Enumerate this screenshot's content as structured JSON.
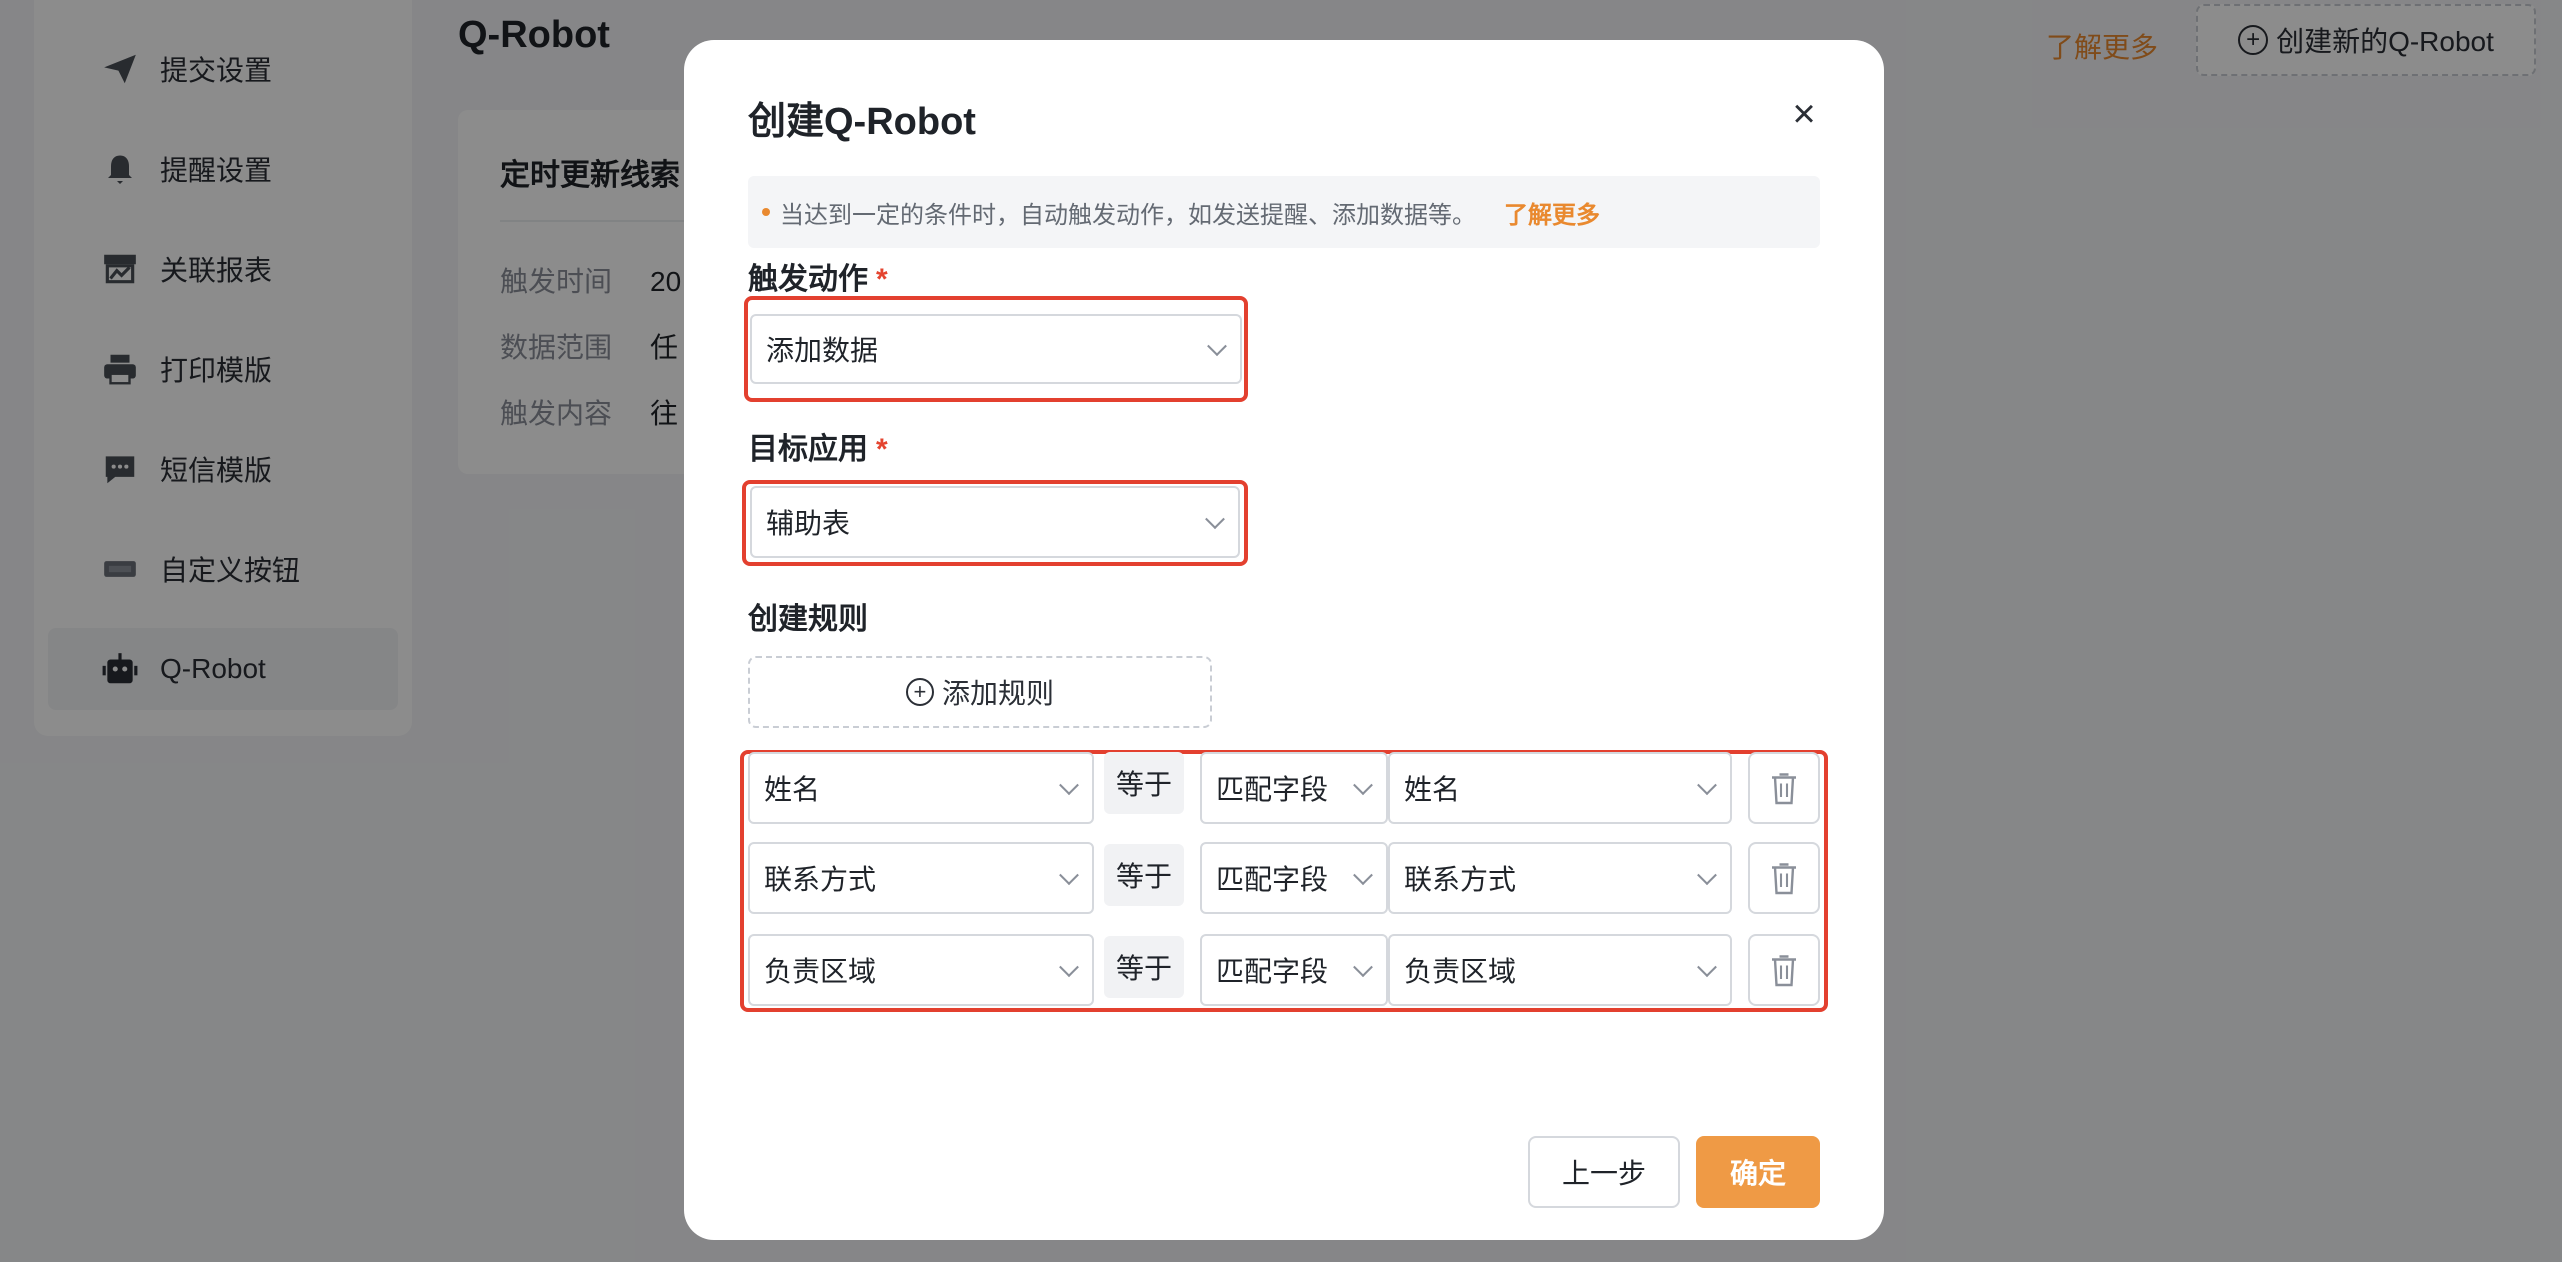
{
  "sidebar": {
    "items": [
      {
        "label": "提交设置",
        "icon": "paper-plane-icon"
      },
      {
        "label": "提醒设置",
        "icon": "bell-icon"
      },
      {
        "label": "关联报表",
        "icon": "report-icon"
      },
      {
        "label": "打印模版",
        "icon": "printer-icon"
      },
      {
        "label": "短信模版",
        "icon": "message-icon"
      },
      {
        "label": "自定义按钮",
        "icon": "btn-icon"
      },
      {
        "label": "Q-Robot",
        "icon": "robot-icon"
      }
    ],
    "active_index": 6
  },
  "header": {
    "title": "Q-Robot",
    "learn_more": "了解更多",
    "create_label": "创建新的Q-Robot"
  },
  "card": {
    "title": "定时更新线索",
    "rows": [
      {
        "label": "触发时间",
        "value": "20"
      },
      {
        "label": "数据范围",
        "value": "任"
      },
      {
        "label": "触发内容",
        "value": "往"
      }
    ]
  },
  "modal": {
    "title": "创建Q-Robot",
    "tip_text": "当达到一定的条件时，自动触发动作，如发送提醒、添加数据等。",
    "tip_link": "了解更多",
    "trigger_label": "触发动作",
    "trigger_value": "添加数据",
    "target_label": "目标应用",
    "target_value": "辅助表",
    "rules_label": "创建规则",
    "add_rule_label": "添加规则",
    "required_mark": "*",
    "rules": [
      {
        "field": "姓名",
        "op": "等于",
        "mode": "匹配字段",
        "target": "姓名"
      },
      {
        "field": "联系方式",
        "op": "等于",
        "mode": "匹配字段",
        "target": "联系方式"
      },
      {
        "field": "负责区域",
        "op": "等于",
        "mode": "匹配字段",
        "target": "负责区域"
      }
    ],
    "prev_label": "上一步",
    "ok_label": "确定"
  },
  "colors": {
    "accent": "#ef9a45",
    "link": "#e9892f",
    "highlight": "#e3402f",
    "required": "#e4442f"
  }
}
